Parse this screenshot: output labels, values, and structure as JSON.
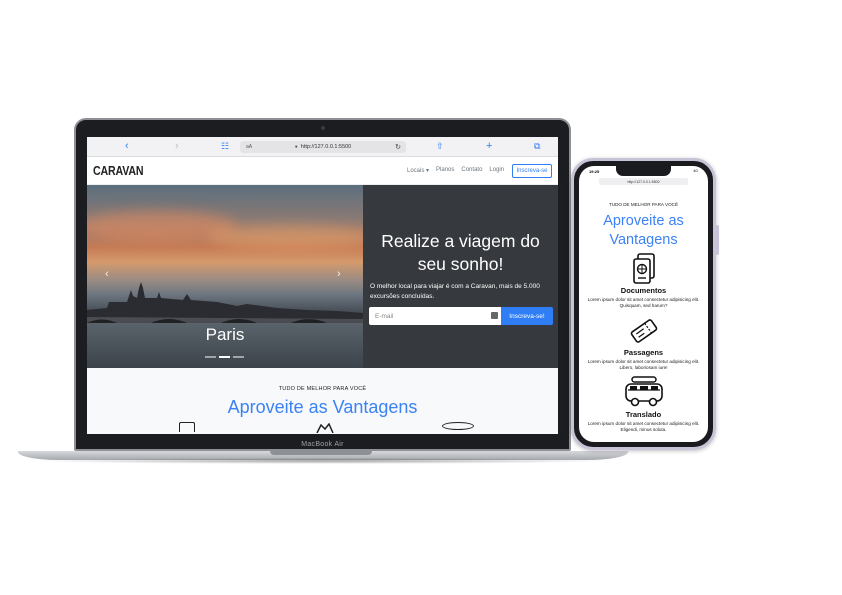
{
  "macbook": {
    "model_label": "MacBook Air"
  },
  "safari": {
    "text_size_label": "aA",
    "url": "http://127.0.0.1:5500"
  },
  "site": {
    "brand": "CARAVAN",
    "nav": {
      "locais": "Locais",
      "planos": "Planos",
      "contato": "Contato",
      "login": "Login",
      "signup": "Inscreva-se"
    },
    "carousel": {
      "caption": "Paris"
    },
    "cta": {
      "title": "Realize a viagem do seu sonho!",
      "text": "O melhor local para viajar é com a Caravan, mais de 5.000 excursões concluídas.",
      "email_placeholder": "E-mail",
      "button": "Inscreva-se!"
    },
    "benefits": {
      "eyebrow": "TUDO DE MELHOR PARA VOCÊ",
      "title": "Aproveite as Vantagens"
    }
  },
  "iphone": {
    "time": "19:25",
    "status": "4G",
    "url": "http://127.0.0.1:5500",
    "eyebrow": "TUDO DE MELHOR PARA VOCÊ",
    "title": "Aproveite as Vantagens",
    "features": [
      {
        "name": "Documentos",
        "desc": "Lorem ipsum dolor sit amet consectetur adipisicing elit. Quisquam, sed harum?"
      },
      {
        "name": "Passagens",
        "desc": "Lorem ipsum dolor sit amet consectetur adipisicing elit. Libero, laboriosam iure!"
      },
      {
        "name": "Translado",
        "desc": "Lorem ipsum dolor sit amet consectetur adipisicing elit. Eligendi, minus soluta."
      }
    ]
  },
  "colors": {
    "accent": "#2f7ef6",
    "cta_panel": "#36393e",
    "section_bg": "#f8f9fa"
  }
}
